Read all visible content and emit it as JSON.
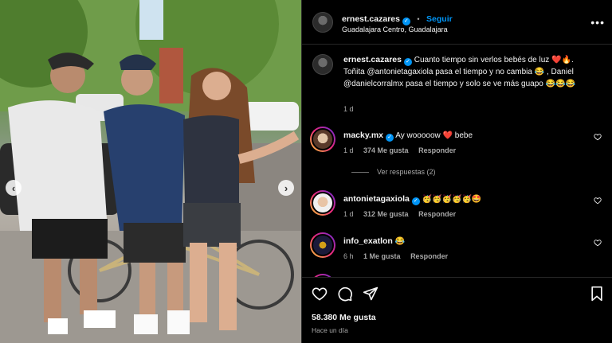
{
  "post": {
    "username": "ernest.cazares",
    "follow_label": "Seguir",
    "separator": "•",
    "location": "Guadalajara Centro, Guadalajara",
    "more_label": "•••"
  },
  "caption": {
    "username": "ernest.cazares",
    "text": "Cuanto tiempo sin verlos bebés de luz ❤️🔥. Toñita @antonietagaxiola pasa el tiempo y no cambia 😂 , Daniel @danielcorralmx pasa el tiempo y solo se ve más guapo 😂😂😂",
    "time": "1 d"
  },
  "comments": [
    {
      "username": "macky.mx",
      "text": "Ay wooooow ❤️ bebe",
      "time": "1 d",
      "likes": "374 Me gusta",
      "reply_label": "Responder",
      "view_replies": "Ver respuestas (2)"
    },
    {
      "username": "antonietagaxiola",
      "text": "🥳🥳🥳🥳🥳🤩",
      "time": "1 d",
      "likes": "312 Me gusta",
      "reply_label": "Responder"
    },
    {
      "username": "info_exatlon",
      "text": "😂",
      "time": "6 h",
      "likes": "1 Me gusta",
      "reply_label": "Responder"
    }
  ],
  "footer": {
    "likes": "58.380 Me gusta",
    "ago": "Hace un día"
  },
  "nav": {
    "prev": "‹",
    "next": "›"
  },
  "colors": {
    "accent": "#0095f6",
    "background": "#000000",
    "muted": "#a8a8a8",
    "heart": "#ff3040"
  },
  "icons": [
    "heart-icon",
    "comment-icon",
    "share-icon",
    "bookmark-icon",
    "more-icon",
    "verified-icon"
  ]
}
